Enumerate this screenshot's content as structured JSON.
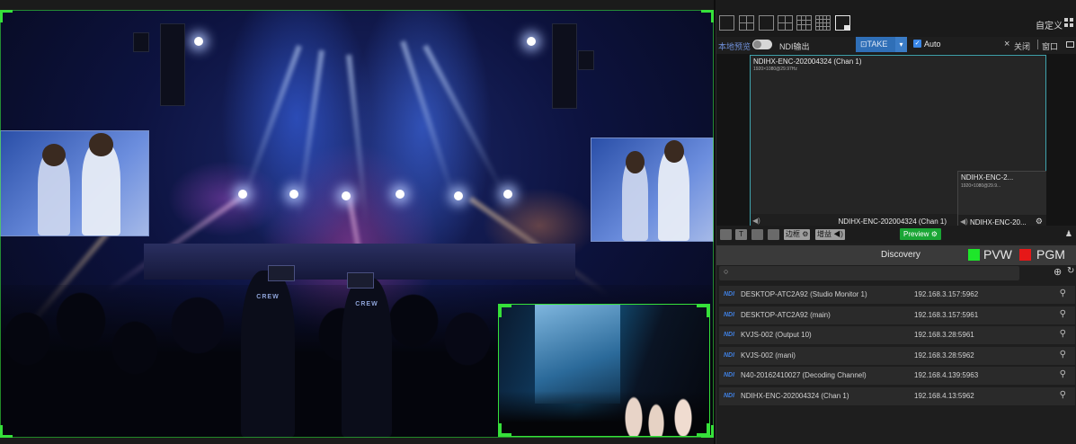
{
  "layouts": [
    {
      "name": "layout-1x1"
    },
    {
      "name": "layout-2x2"
    },
    {
      "name": "layout-1-plus-3"
    },
    {
      "name": "layout-4-quad"
    },
    {
      "name": "layout-3x3"
    },
    {
      "name": "layout-4x4"
    },
    {
      "name": "layout-pip"
    }
  ],
  "custom_label": "自定义",
  "controls": {
    "local_preview": "本地预览",
    "ndi_output": "NDI输出",
    "take": "TAKE",
    "auto": "Auto",
    "close": "关闭",
    "window": "窗口"
  },
  "monitor": {
    "main_name": "NDIHX-ENC-202004324 (Chan 1)",
    "main_res": "1920×1080@29.97Hz",
    "main_footer": "NDIHX-ENC-202004324 (Chan 1)",
    "sub_name": "NDIHX-ENC-2...",
    "sub_res": "1920×1080@29.9...",
    "sub_footer": "NDIHX-ENC-20..."
  },
  "tools": {
    "border_label": "边框",
    "gain_label": "增益",
    "preview_label": "Preview"
  },
  "discovery": {
    "title": "Discovery",
    "pvw": "PVW",
    "pgm": "PGM",
    "pvw_color": "#1ee62a",
    "pgm_color": "#e61818"
  },
  "search": {
    "placeholder": ""
  },
  "sources": [
    {
      "tag": "NDI",
      "name": "DESKTOP-ATC2A92 (Studio Monitor 1)",
      "ip": "192.168.3.157:5962"
    },
    {
      "tag": "NDI",
      "name": "DESKTOP-ATC2A92 (main)",
      "ip": "192.168.3.157:5961"
    },
    {
      "tag": "NDI",
      "name": "KVJS-002 (Output 10)",
      "ip": "192.168.3.28:5961"
    },
    {
      "tag": "NDI",
      "name": "KVJS-002 (mani)",
      "ip": "192.168.3.28:5962"
    },
    {
      "tag": "NDI",
      "name": "N40-20162410027 (Decoding Channel)",
      "ip": "192.168.4.139:5963"
    },
    {
      "tag": "NDI",
      "name": "NDIHX-ENC-202004324 (Chan 1)",
      "ip": "192.168.4.13:5962"
    }
  ]
}
